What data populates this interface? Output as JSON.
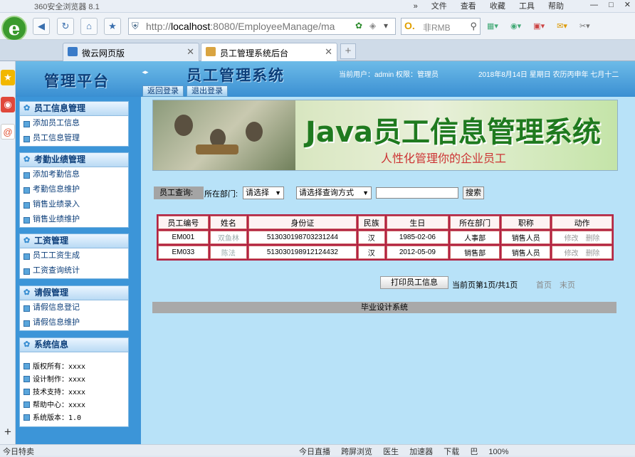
{
  "browser": {
    "window_title": "360安全浏览器 8.1",
    "menu": [
      "»",
      "文件",
      "查看",
      "收藏",
      "工具",
      "帮助"
    ],
    "url_prefix": "http://",
    "url_host": "localhost",
    "url_rest": ":8080/EmployeeManage/ma",
    "search_value": "非RMB",
    "tabs": [
      {
        "label": "微云网页版"
      },
      {
        "label": "员工管理系统后台"
      }
    ],
    "new_tab": "+",
    "status_left": "今日特卖",
    "status_right": [
      "今日直播",
      "跨屏浏览",
      "医生",
      "加速器",
      "下载",
      "巴",
      "100%"
    ]
  },
  "app": {
    "brand": "管理平台",
    "title": "员工管理系统",
    "user_info": "当前用户：admin 权限：管理员",
    "date_info": "2018年8月14日 星期日 农历丙申年 七月十二",
    "btn_back": "返回登录",
    "btn_logout": "退出登录"
  },
  "menu": {
    "employee": {
      "title": "员工信息管理",
      "items": [
        "添加员工信息",
        "员工信息管理"
      ]
    },
    "attendance": {
      "title": "考勤业绩管理",
      "items": [
        "添加考勤信息",
        "考勤信息维护",
        "销售业绩录入",
        "销售业绩维护"
      ]
    },
    "salary": {
      "title": "工资管理",
      "items": [
        "员工工资生成",
        "工资查询统计"
      ]
    },
    "leave": {
      "title": "请假管理",
      "items": [
        "请假信息登记",
        "请假信息维护"
      ]
    },
    "sysinfo": {
      "title": "系统信息",
      "items": [
        "版权所有：xxxx",
        "设计制作：xxxx",
        "技术支持：xxxx",
        "帮助中心：xxxx",
        "系统版本：1.0"
      ]
    }
  },
  "banner": {
    "title": "Java员工信息管理系统",
    "subtitle": "人性化管理你的企业员工"
  },
  "query": {
    "label": "员工查询:",
    "dept_label": "所在部门:",
    "dept_select": "请选择",
    "mode_select": "请选择查询方式",
    "button": "搜索"
  },
  "table": {
    "headers": [
      "员工编号",
      "姓名",
      "身份证",
      "民族",
      "生日",
      "所在部门",
      "职称",
      "动作"
    ],
    "rows": [
      {
        "id": "EM001",
        "name": "双鱼林",
        "idcard": "513030198703231244",
        "nation": "汉",
        "birthday": "1985-02-06",
        "dept": "人事部",
        "title": "销售人员",
        "edit": "修改",
        "del": "删除"
      },
      {
        "id": "EM033",
        "name": "陈法",
        "idcard": "513030198912124432",
        "nation": "汉",
        "birthday": "2012-05-09",
        "dept": "销售部",
        "title": "销售人员",
        "edit": "修改",
        "del": "删除"
      }
    ]
  },
  "pager": {
    "print_button": "打印员工信息",
    "info": "当前页第1页/共1页",
    "first": "首页",
    "last": "末页"
  },
  "footer": "毕业设计系统"
}
